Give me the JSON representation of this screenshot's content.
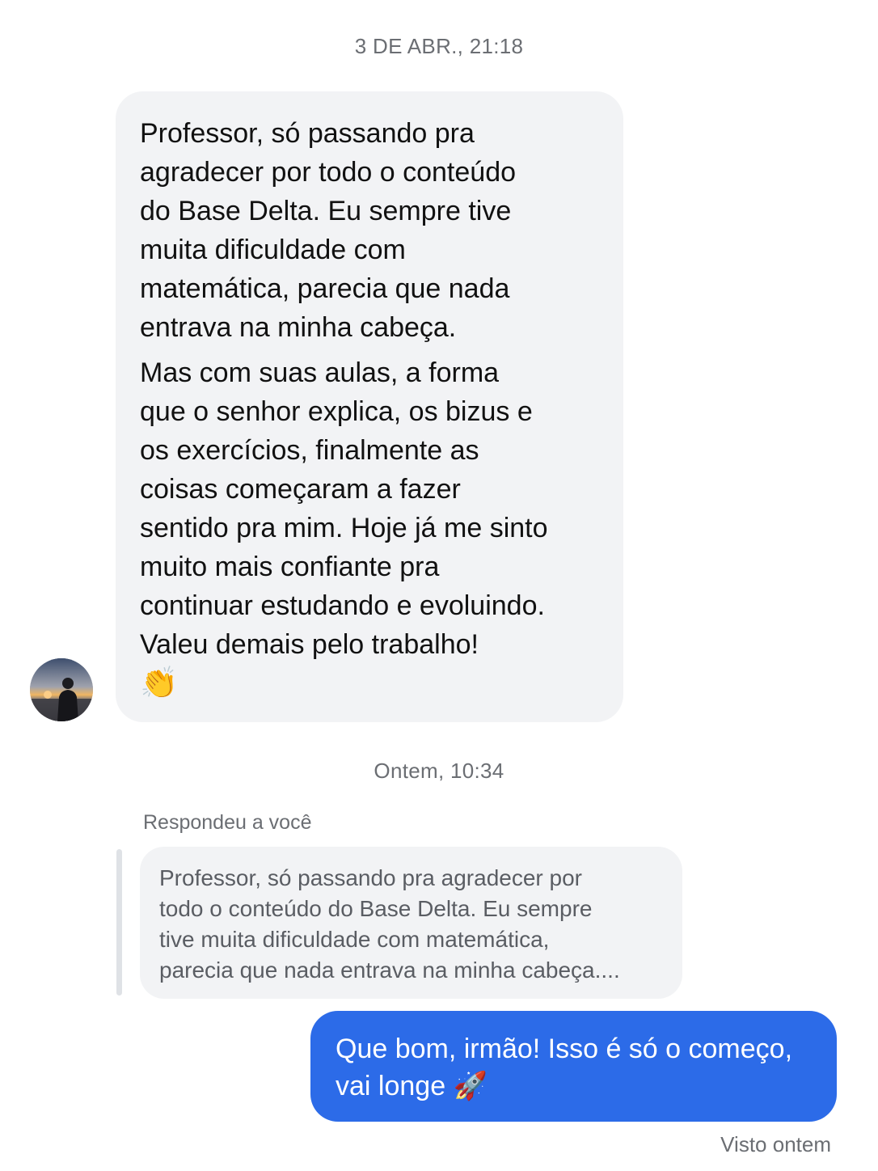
{
  "conversation": {
    "timestamp_1": "3 DE ABR., 21:18",
    "incoming_message": {
      "paragraph_1": "Professor, só passando pra\nagradecer por todo o conteúdo\ndo Base Delta. Eu sempre tive\nmuita dificuldade com\nmatemática, parecia que nada\nentrava na minha cabeça.",
      "paragraph_2": "Mas com suas aulas, a forma\nque o senhor explica, os bizus e\nos exercícios, finalmente as\ncoisas começaram a fazer\nsentido pra mim. Hoje já me sinto\nmuito mais confiante pra\ncontinuar estudando e evoluindo.\nValeu demais pelo trabalho!",
      "emoji": "👏"
    },
    "timestamp_2": "Ontem, 10:34",
    "reply": {
      "label": "Respondeu a você",
      "quoted_text": "Professor, só passando pra agradecer por\ntodo o conteúdo do Base Delta. Eu sempre\ntive muita dificuldade com matemática,\nparecia que nada entrava na minha cabeça...."
    },
    "outgoing_message": {
      "text": "Que bom, irmão! Isso é só o começo,\nvai longe 🚀"
    },
    "seen_status": "Visto ontem"
  },
  "colors": {
    "incoming_bubble": "#f2f3f5",
    "outgoing_bubble": "#2c6be8",
    "muted_text": "#6b6e73"
  }
}
